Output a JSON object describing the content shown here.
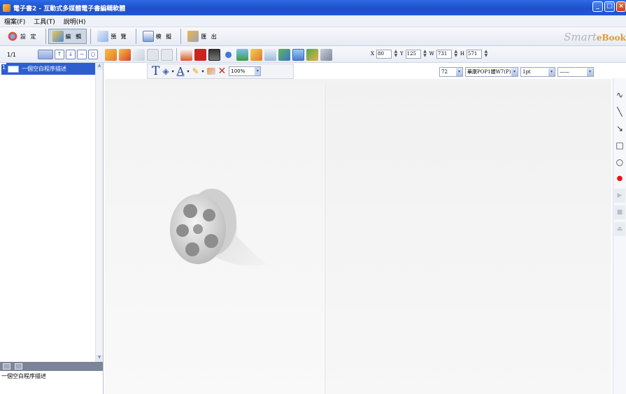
{
  "window": {
    "title": "電子書2 - 互動式多媒體電子書編輯軟體"
  },
  "menu": {
    "items": [
      "檔案(F)",
      "工具(T)",
      "說明(H)"
    ]
  },
  "modes": [
    {
      "label": "設 定",
      "icon": "settings-icon"
    },
    {
      "label": "編 輯",
      "icon": "edit-icon",
      "active": true
    },
    {
      "label": "預 覽",
      "icon": "preview-icon"
    },
    {
      "label": "模 擬",
      "icon": "simulate-icon"
    },
    {
      "label": "匯 出",
      "icon": "export-icon"
    }
  ],
  "brand": {
    "text": "Smart",
    "suffix": "eBook"
  },
  "pages": {
    "counter": "1/1",
    "items": [
      {
        "index": "1",
        "label": "一個空白程序描述"
      }
    ]
  },
  "properties": {
    "x_label": "X",
    "x": "80",
    "y_label": "Y",
    "y": "125",
    "w_label": "W",
    "w": "731",
    "h_label": "H",
    "h": "571"
  },
  "format": {
    "zoom": "100%"
  },
  "font": {
    "size": "72",
    "family": "華康POP1體W7(P)",
    "line_width": "1pt",
    "line_style": "——"
  },
  "notes": {
    "text": "一個空白程序描述"
  },
  "draw_tools": [
    "curve-icon",
    "line-icon",
    "arrow-icon",
    "rectangle-icon",
    "ellipse-icon",
    "record-icon",
    "play-icon",
    "stop-icon",
    "eject-icon"
  ]
}
